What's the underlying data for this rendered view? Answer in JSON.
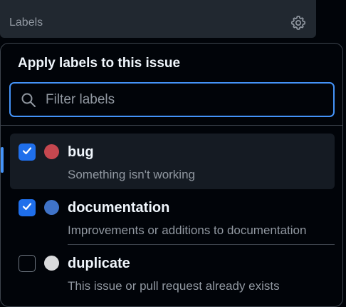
{
  "header": {
    "title": "Labels",
    "settings_icon": "gear-icon"
  },
  "panel": {
    "title": "Apply labels to this issue",
    "filter": {
      "placeholder": "Filter labels",
      "value": "",
      "icon": "search-icon"
    },
    "labels": [
      {
        "name": "bug",
        "description": "Something isn't working",
        "color": "#d73a4a",
        "checked": true,
        "active": true
      },
      {
        "name": "documentation",
        "description": "Improvements or additions to documentation",
        "color": "#0075ca",
        "checked": true,
        "active": false
      },
      {
        "name": "duplicate",
        "description": "This issue or pull request already exists",
        "color": "#cfd3d7",
        "checked": false,
        "active": false
      }
    ]
  },
  "colors": {
    "accent": "#4493f8",
    "checkbox_checked": "#1f6feb",
    "panel_bg": "#010409",
    "border": "#3d444d",
    "text_primary": "#f0f6fc",
    "text_muted": "#9198a1"
  }
}
